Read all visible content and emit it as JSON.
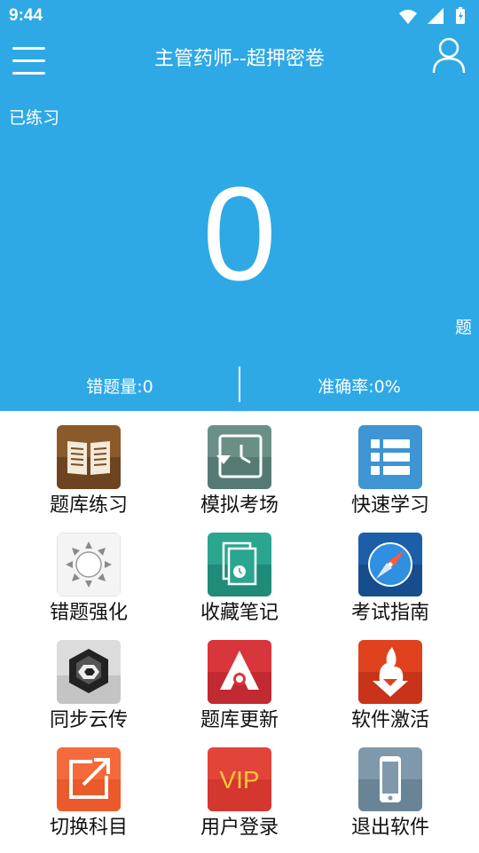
{
  "status_bar": {
    "time": "9:44"
  },
  "app_bar": {
    "title": "主管药师--超押密卷"
  },
  "summary": {
    "practiced_label": "已练习",
    "practiced_count": "0",
    "unit": "题",
    "wrong_count": "错题量:0",
    "accuracy": "准确率:0%"
  },
  "grid": {
    "items": [
      {
        "label": "题库练习"
      },
      {
        "label": "模拟考场"
      },
      {
        "label": "快速学习"
      },
      {
        "label": "错题强化"
      },
      {
        "label": "收藏笔记"
      },
      {
        "label": "考试指南"
      },
      {
        "label": "同步云传"
      },
      {
        "label": "题库更新"
      },
      {
        "label": "软件激活"
      },
      {
        "label": "切换科目"
      },
      {
        "label": "用户登录"
      },
      {
        "label": "退出软件"
      }
    ],
    "vip_text": "VIP"
  },
  "colors": {
    "primary": "#2ea9e6",
    "text_dark": "#111111"
  }
}
